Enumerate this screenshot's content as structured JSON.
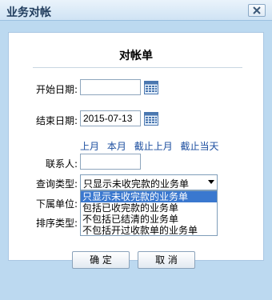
{
  "window": {
    "title": "业务对帐"
  },
  "form": {
    "heading": "对帐单",
    "start_date": {
      "label": "开始日期:",
      "value": ""
    },
    "end_date": {
      "label": "结束日期:",
      "value": "2015-07-13"
    },
    "quick_links": [
      "上月",
      "本月",
      "截止上月",
      "截止当天"
    ],
    "contact": {
      "label": "联系人:",
      "value": ""
    },
    "query_type": {
      "label": "查询类型:",
      "selected": "只显示未收完款的业务单",
      "options": [
        "只显示未收完款的业务单",
        "包括已收完款的业务单",
        "不包括已结清的业务单",
        "不包括开过收款单的业务单"
      ]
    },
    "subunit": {
      "label": "下属单位:"
    },
    "sort_type": {
      "label": "排序类型:"
    }
  },
  "buttons": {
    "ok": "确 定",
    "cancel": "取 消"
  },
  "icons": {
    "close": "close-icon",
    "calendar": "calendar-icon"
  }
}
